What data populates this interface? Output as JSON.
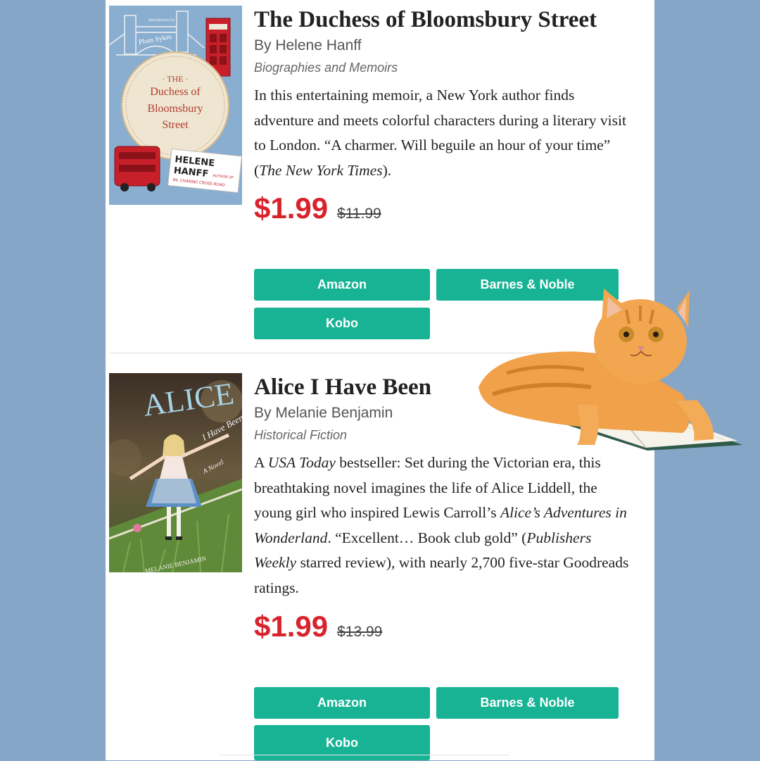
{
  "books": [
    {
      "title": "The Duchess of Bloomsbury Street",
      "author": "By Helene Hanff",
      "genre": "Biographies and Memoirs",
      "description_parts": [
        "In this entertaining memoir, a New York author finds adventure and meets colorful characters during a literary visit to London. “A charmer. Will beguile an hour of your time” (",
        "The New York Times",
        ")."
      ],
      "price": "$1.99",
      "original_price": "$11.99",
      "buttons": {
        "amazon": "Amazon",
        "bn": "Barnes & Noble",
        "kobo": "Kobo"
      },
      "cover": {
        "intro": "Introduction by",
        "intro_name": "Plum Sykes",
        "t1": "· THE ·",
        "t2": "Duchess of",
        "t3": "Bloomsbury",
        "t4": "Street",
        "author1": "HELENE",
        "author2": "HANFF",
        "author_of": "AUTHOR OF",
        "other_book": "84, CHARING CROSS ROAD"
      }
    },
    {
      "title": "Alice I Have Been",
      "author": "By Melanie Benjamin",
      "genre": "Historical Fiction",
      "description_parts": [
        "A ",
        "USA Today",
        " bestseller: Set during the Victorian era, this breathtaking novel imagines the life of Alice Liddell, the young girl who inspired Lewis Carroll’s ",
        "Alice’s Adventures in Wonderland",
        ". “Excellent… Book club gold” (",
        "Publishers Weekly",
        " starred review), with nearly 2,700 five-star Goodreads ratings."
      ],
      "price": "$1.99",
      "original_price": "$13.99",
      "buttons": {
        "amazon": "Amazon",
        "bn": "Barnes & Noble",
        "kobo": "Kobo"
      },
      "cover": {
        "title": "ALICE",
        "subtitle": "I Have Been",
        "novel": "A Novel",
        "author": "MELANIE BENJAMIN"
      }
    }
  ],
  "colors": {
    "background": "#86a6c8",
    "button": "#17b394",
    "price": "#d9232c",
    "cover1": "#8aaed0",
    "cover2": "#3a4a2e"
  }
}
